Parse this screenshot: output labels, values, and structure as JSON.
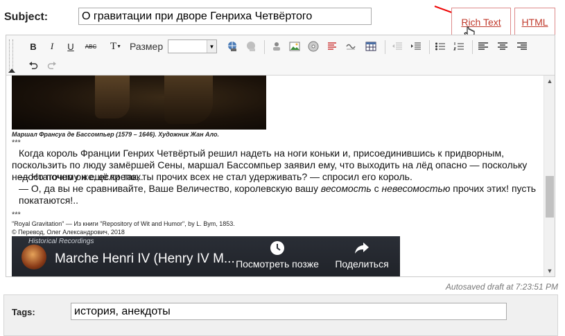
{
  "subject": {
    "label": "Subject:",
    "value": "О гравитации при дворе Генриха Четвёртого"
  },
  "mode_tabs": {
    "rich_text": "Rich Text",
    "html": "HTML"
  },
  "toolbar": {
    "bold": "B",
    "italic": "I",
    "underline": "U",
    "strike": "ABC",
    "font_color": "T",
    "size_label": "Размер",
    "size_value": ""
  },
  "content": {
    "caption": "Маршал Франсуа де Бассомпьер (1579 – 1646). Художник Жан Ало.",
    "stars": "***",
    "p1": "Когда король Франции Генрих Четвёртый решил надеть на ноги коньки и, присоединившись к придворным, поскользить по люду замёршей Сены, маршал Бассомпьер заявил ему, что выходить на лёд опасно — поскольку недостаточно он ещё крепок.",
    "p2": "— Но почему же, если так, ты прочих всех не стал удерживать? — спросил его король.",
    "p3_start": "— О, да вы не сравнивайте, Ваше Величество, королевскую вашу ",
    "p3_italic1": "весомость",
    "p3_mid": " с ",
    "p3_italic2": "невесомостью",
    "p3_end": " прочих этих! пусть покатаются!..",
    "credit1": "\"Royal Gravitation\" — Из книги \"Repository of Wit and Humor\", by L. Bym, 1853.",
    "credit2": "© Перевод, Олег Александрович, 2018"
  },
  "video": {
    "channel": "Historical Recordings",
    "title": "Marche Henri IV (Henry IV M...",
    "watch_later": "Посмотреть позже",
    "share": "Поделиться"
  },
  "autosave": "Autosaved draft at 7:23:51 PM",
  "tags": {
    "label": "Tags:",
    "value": "история, анекдоты"
  },
  "colors": {
    "accent": "#c0392b",
    "tab_border": "#dd8888"
  }
}
